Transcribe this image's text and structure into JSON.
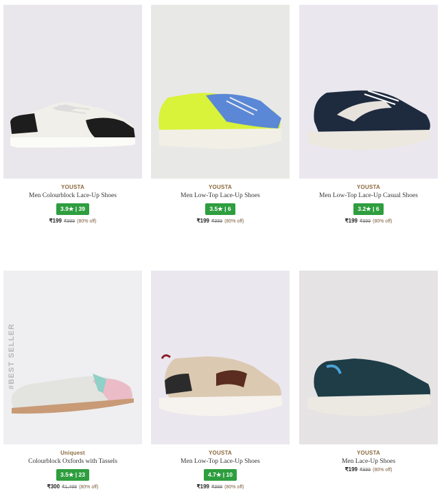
{
  "products": [
    {
      "brand": "YOUSTA",
      "name": "Men Colourblock Lace-Up Shoes",
      "rating": "3.9★ | 39",
      "price": "₹199",
      "mrp": "₹999",
      "discount": "(80% off)",
      "bg": "#e9e6ec"
    },
    {
      "brand": "YOUSTA",
      "name": "Men Low-Top Lace-Up Shoes",
      "rating": "3.5★ | 6",
      "price": "₹199",
      "mrp": "₹999",
      "discount": "(80% off)",
      "bg": "#e8e8e6"
    },
    {
      "brand": "YOUSTA",
      "name": "Men Low-Top Lace-Up Casual Shoes",
      "rating": "3.2★ | 6",
      "price": "₹199",
      "mrp": "₹999",
      "discount": "(80% off)",
      "bg": "#eae7ee"
    },
    {
      "brand": "Uniquest",
      "name": "Colourblock Oxfords with Tassels",
      "rating": "3.5★ | 23",
      "price": "₹300",
      "mrp": "₹1,499",
      "discount": "(80% off)",
      "bg": "#efeff1",
      "badge": "#BEST SELLER"
    },
    {
      "brand": "YOUSTA",
      "name": "Men Low-Top Lace-Up Shoes",
      "rating": "4.7★ | 10",
      "price": "₹199",
      "mrp": "₹999",
      "discount": "(80% off)",
      "bg": "#eae7ee"
    },
    {
      "brand": "YOUSTA",
      "name": "Men Lace-Up Shoes",
      "rating": "",
      "price": "₹199",
      "mrp": "₹999",
      "discount": "(80% off)",
      "bg": "#e6e3e4"
    }
  ]
}
